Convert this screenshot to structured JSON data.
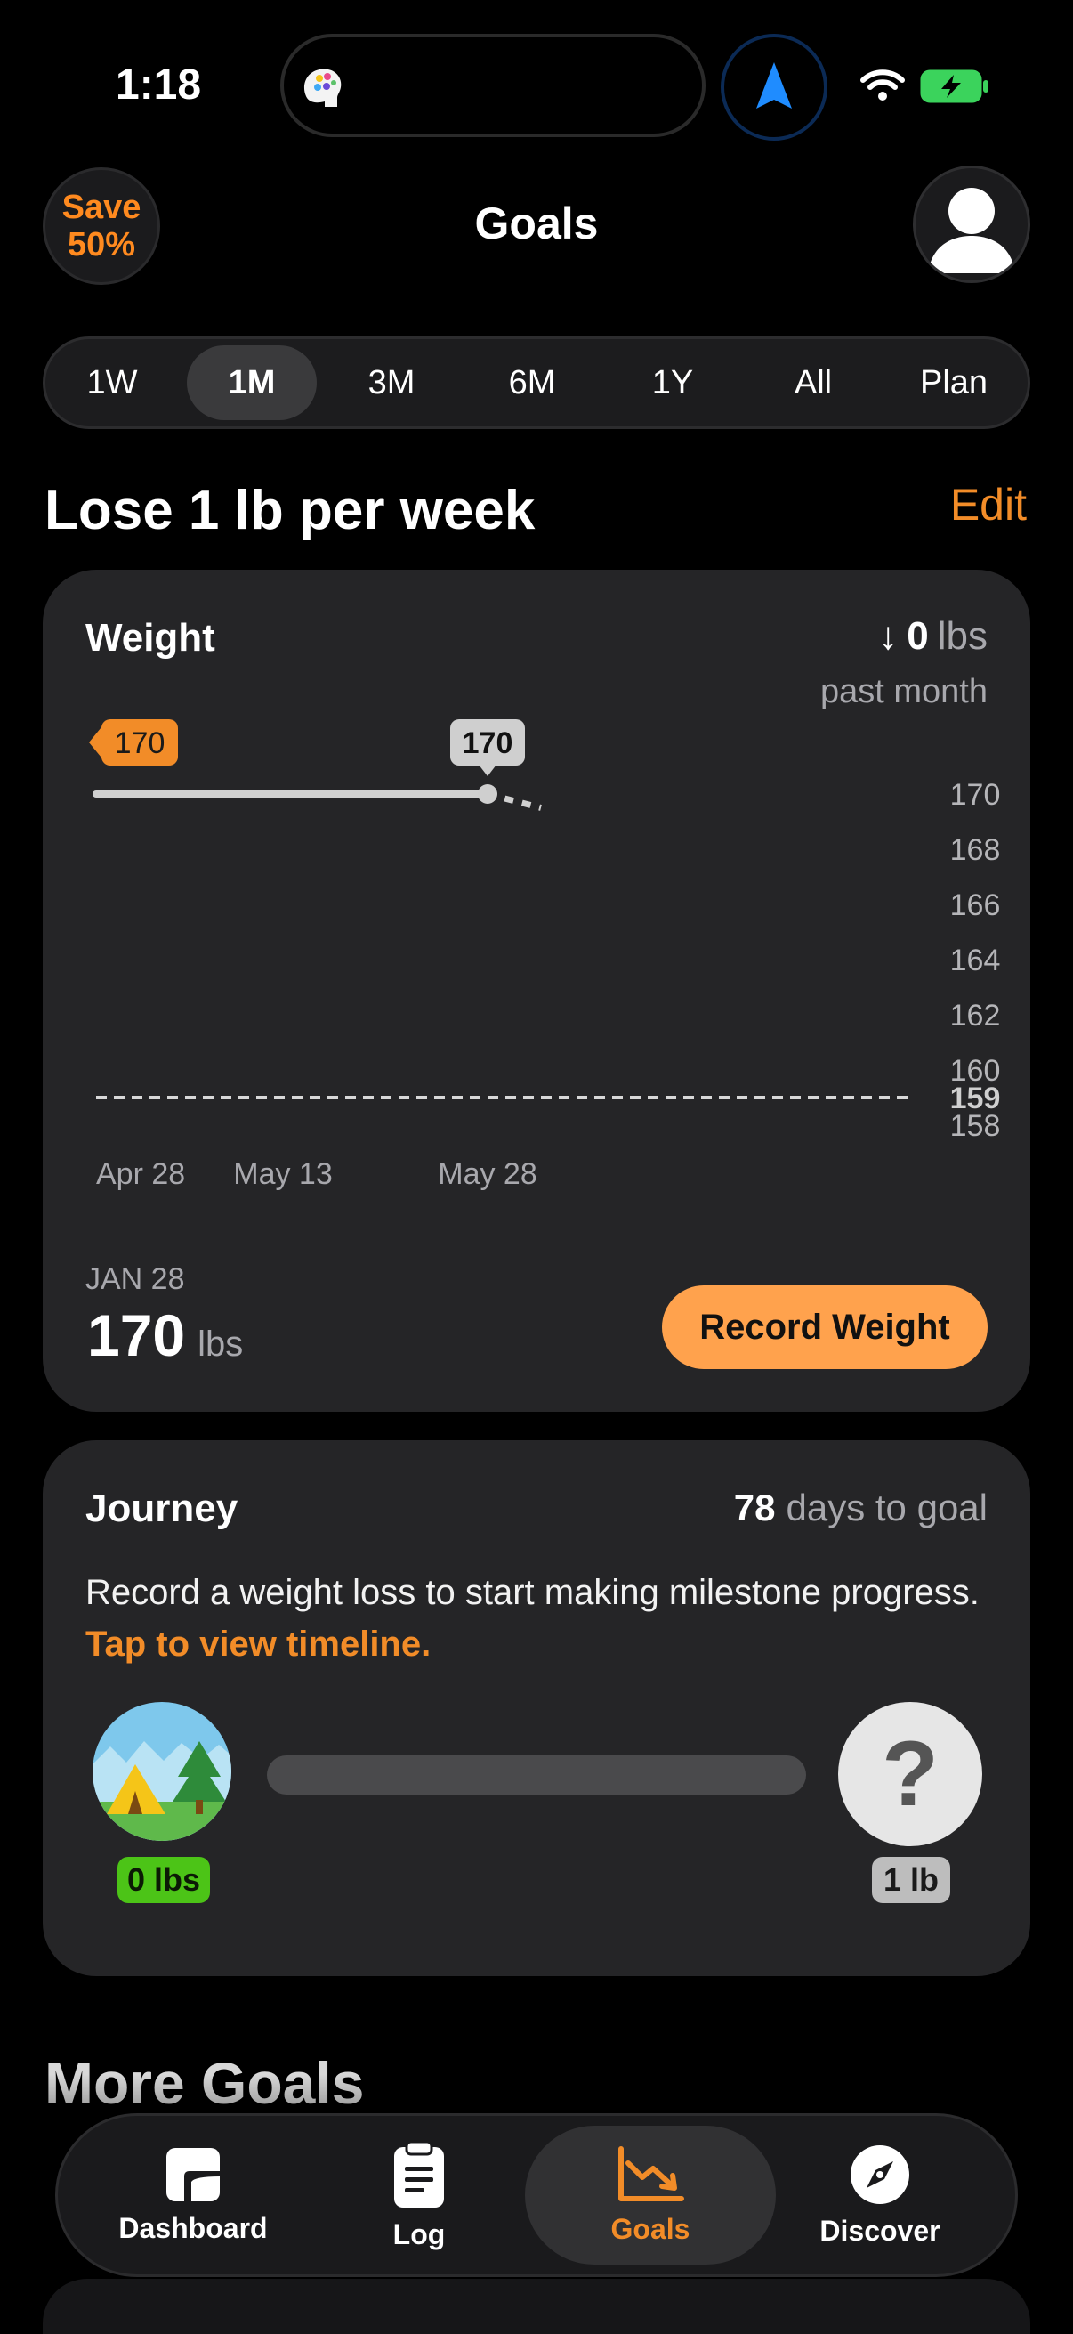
{
  "status_bar": {
    "time": "1:18"
  },
  "header": {
    "promo_badge": {
      "line1": "Save",
      "line2": "50%"
    },
    "title": "Goals"
  },
  "range_tabs": {
    "items": [
      {
        "label": "1W"
      },
      {
        "label": "1M"
      },
      {
        "label": "3M"
      },
      {
        "label": "6M"
      },
      {
        "label": "1Y"
      },
      {
        "label": "All"
      },
      {
        "label": "Plan"
      }
    ],
    "active": "1M"
  },
  "goal": {
    "title": "Lose 1 lb per week",
    "edit_label": "Edit"
  },
  "weight_card": {
    "title": "Weight",
    "change_arrow": "↓",
    "change_value": "0",
    "change_unit": "lbs",
    "change_period": "past month",
    "latest": {
      "date": "JAN 28",
      "value": "170",
      "unit": "lbs"
    },
    "record_button": "Record Weight"
  },
  "chart_data": {
    "type": "line",
    "x_ticks": [
      "Apr 28",
      "May 13",
      "May 28"
    ],
    "y_ticks": [
      "170",
      "168",
      "166",
      "164",
      "162",
      "160",
      "158"
    ],
    "ylim": [
      158,
      170
    ],
    "start_marker": "170",
    "current_marker": "170",
    "goal_label": "159",
    "series": [
      {
        "name": "",
        "style": "solid",
        "points": [
          {
            "x": "Apr 28",
            "y": 170
          },
          {
            "x": "May 28",
            "y": 170
          }
        ]
      },
      {
        "name": "",
        "style": "dotted",
        "points": [
          {
            "x": "May 28",
            "y": 170
          },
          {
            "x": "Jun 1",
            "y": 169.5
          }
        ]
      }
    ],
    "goal_line": 159,
    "colors": {
      "line": "#d0d0d0",
      "start_marker": "#f28c28",
      "goal_line": "#d8d8d8"
    }
  },
  "journey_card": {
    "title": "Journey",
    "days_value": "78",
    "days_label": "days to goal",
    "message": "Record a weight loss to start making milestone progress.",
    "link": "Tap to view timeline.",
    "start_badge": "0 lbs",
    "end_badge": "1 lb",
    "end_icon": "?",
    "progress": 0
  },
  "more_goals": {
    "title": "More Goals"
  },
  "bottom_nav": {
    "items": [
      {
        "label": "Dashboard",
        "icon": "dashboard-icon"
      },
      {
        "label": "Log",
        "icon": "clipboard-icon"
      },
      {
        "label": "Goals",
        "icon": "chart-down-icon"
      },
      {
        "label": "Discover",
        "icon": "compass-icon"
      }
    ],
    "active": "Goals"
  },
  "colors": {
    "accent": "#f28c28",
    "button": "#ffa24d",
    "card": "#252527",
    "success": "#4cc417"
  }
}
